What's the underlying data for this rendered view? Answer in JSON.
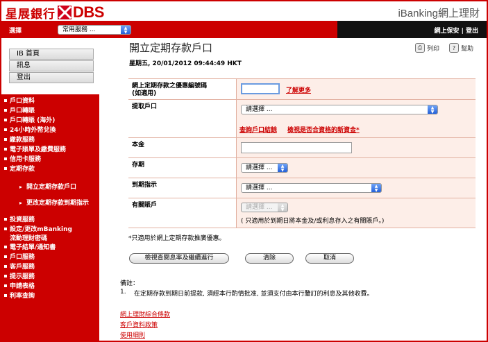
{
  "header": {
    "logo_cn": "星展銀行",
    "logo_en": "DBS",
    "product_title": "iBanking網上理財"
  },
  "topbar": {
    "select_label": "選擇",
    "service_select_value": "常用服務 ...",
    "right_links": "網上保安 | 登出"
  },
  "sidebar": {
    "top_buttons": [
      "IB 首頁",
      "訊息",
      "登出"
    ],
    "menu": [
      "戶口資料",
      "戶口轉賬",
      "戶口轉賬 (海外)",
      "24小時外幣兌換",
      "繳款服務",
      "電子賬單及繳費服務",
      "信用卡服務",
      "定期存款"
    ],
    "submenu": [
      "開立定期存款戶口",
      "更改定期存款到期指示"
    ],
    "menu2": [
      "投資服務",
      "設定/更改mBanking",
      "流動理財密碼",
      "電子結單/通知書",
      "戶口服務",
      "客戶服務",
      "提示服務",
      "申請表格",
      "利率查詢"
    ]
  },
  "page": {
    "title": "開立定期存款戶口",
    "print_label": "列印",
    "help_label": "幫助",
    "datetime": "星期五, 20/01/2012 09:44:49 HKT"
  },
  "form": {
    "promo_label_1": "網上定期存款之優惠編號碼",
    "promo_label_2": "(如適用)",
    "promo_value": "",
    "learn_more": "了解更多",
    "withdraw_label": "提取戶口",
    "withdraw_value": "請選擇 ...",
    "link_account_balance": "查詢戶口結餘",
    "link_check_funds": "檢視是否合資格的新資金*",
    "principal_label": "本金",
    "principal_value": "",
    "term_label": "存期",
    "term_value": "請選擇 ...",
    "maturity_label": "到期指示",
    "maturity_value": "請選擇 ...",
    "related_label": "有關賬戶",
    "related_value": "請選擇 ...",
    "related_note": "( 只適用於到期日將本金及/或利息存入之有關賬戶。)"
  },
  "footnote": "*只適用於網上定期存款推廣優惠。",
  "buttons": {
    "view_rate": "檢視查閱息率及繼續進行",
    "clear": "清除",
    "cancel": "取消"
  },
  "remarks": {
    "title": "備註：",
    "item_number": "1.",
    "item_text": "在定期存款到期日前提款, 須經本行酌情批准, 並須支付由本行釐訂的利息及其他收費。"
  },
  "footer_links": [
    "網上理財綜合條款",
    "客戶資料政策",
    "使用細則"
  ]
}
